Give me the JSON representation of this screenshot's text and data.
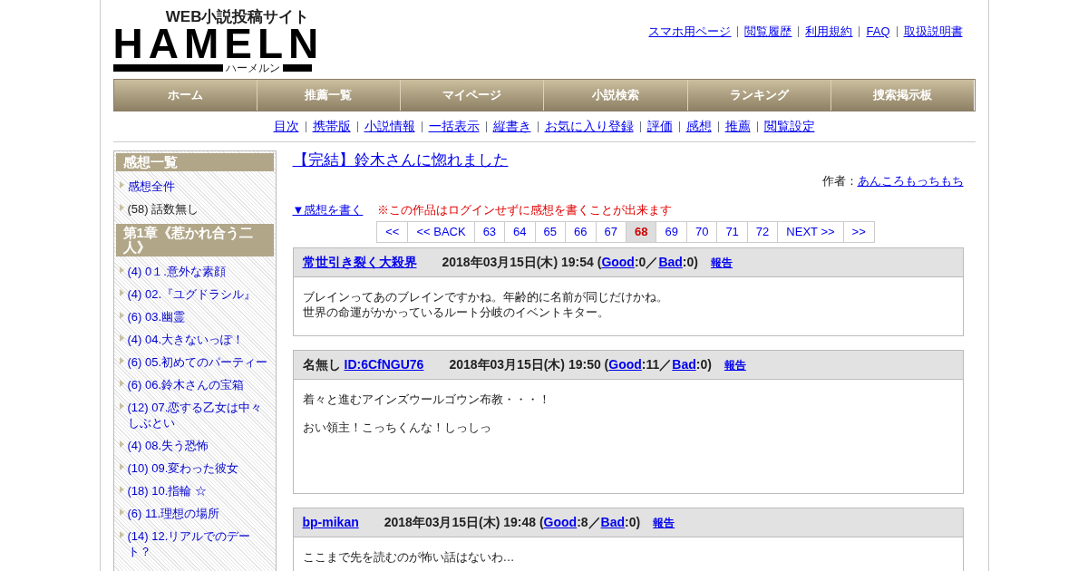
{
  "logo": {
    "tagline": "WEB小説投稿サイト",
    "wordmark": "HAMELN",
    "reading": "ハーメルン"
  },
  "top_links": [
    "スマホ用ページ",
    "閲覧履歴",
    "利用規約",
    "FAQ",
    "取扱説明書"
  ],
  "nav": [
    "ホーム",
    "推薦一覧",
    "マイページ",
    "小説検索",
    "ランキング",
    "捜索掲示板"
  ],
  "sub_nav": [
    "目次",
    "携帯版",
    "小説情報",
    "一括表示",
    "縦書き",
    "お気に入り登録",
    "評価",
    "感想",
    "推薦",
    "閲覧設定"
  ],
  "sidebar": [
    {
      "heading": "感想一覧",
      "items": [
        {
          "text": "感想全件",
          "link": true
        },
        {
          "text": "(58) 話数無し",
          "link": false
        }
      ]
    },
    {
      "heading": "第1章《惹かれ合う二人》",
      "items": [
        {
          "text": "(4) 0１.意外な素顔",
          "link": true
        },
        {
          "text": "(4) 02.『ユグドラシル』",
          "link": true
        },
        {
          "text": "(6) 03.幽霊",
          "link": true
        },
        {
          "text": "(4) 04.大きないっぽ！",
          "link": true
        },
        {
          "text": "(6) 05.初めてのパーティー",
          "link": true
        },
        {
          "text": "(6) 06.鈴木さんの宝箱",
          "link": true
        },
        {
          "text": "(12) 07.恋する乙女は中々しぶとい",
          "link": true
        },
        {
          "text": "(4) 08.失う恐怖",
          "link": true
        },
        {
          "text": "(10) 09.変わった彼女",
          "link": true
        },
        {
          "text": "(18) 10.指輪 ☆",
          "link": true
        },
        {
          "text": "(6) 11.理想の場所",
          "link": true
        },
        {
          "text": "(14) 12.リアルでのデート？",
          "link": true
        }
      ]
    }
  ],
  "work": {
    "title": "【完結】鈴木さんに惚れました",
    "author_label": "作者：",
    "author": "あんころもっちもち"
  },
  "write_link": "▼感想を書く",
  "notice": "※この作品はログインせずに感想を書くことが出来ます",
  "pagination": [
    {
      "label": "<<",
      "selected": false
    },
    {
      "label": "<< BACK",
      "selected": false
    },
    {
      "label": "63",
      "selected": false
    },
    {
      "label": "64",
      "selected": false
    },
    {
      "label": "65",
      "selected": false
    },
    {
      "label": "66",
      "selected": false
    },
    {
      "label": "67",
      "selected": false
    },
    {
      "label": "68",
      "selected": true
    },
    {
      "label": "69",
      "selected": false
    },
    {
      "label": "70",
      "selected": false
    },
    {
      "label": "71",
      "selected": false
    },
    {
      "label": "72",
      "selected": false
    },
    {
      "label": "NEXT >>",
      "selected": false
    },
    {
      "label": ">>",
      "selected": false
    }
  ],
  "comments": [
    {
      "author_link": "常世引き裂く大殺界",
      "date": "2018年03月15日(木) 19:54 (",
      "good_label": "Good",
      "good_count": ":0／",
      "bad_label": "Bad",
      "bad_count": ":0)",
      "report": "報告",
      "paragraphs": [
        [
          "ブレインってあのブレインですかね。年齢的に名前が同じだけかね。",
          "世界の命運がかかっているルート分岐のイベントキター。"
        ]
      ],
      "tall": false
    },
    {
      "author_name": "名無し",
      "author_link": "ID:6CfNGU76",
      "date": "2018年03月15日(木) 19:50 (",
      "good_label": "Good",
      "good_count": ":11／",
      "bad_label": "Bad",
      "bad_count": ":0)",
      "report": "報告",
      "paragraphs": [
        [
          "着々と進むアインズウールゴウン布教・・・！"
        ],
        [
          "おい領主！こっちくんな！しっしっ"
        ]
      ],
      "tall": true
    },
    {
      "author_link": "bp-mikan",
      "date": "2018年03月15日(木) 19:48 (",
      "good_label": "Good",
      "good_count": ":8／",
      "bad_label": "Bad",
      "bad_count": ":0)",
      "report": "報告",
      "paragraphs": [
        [
          "ここまで先を読むのが怖い話はないわ…"
        ]
      ],
      "tall": false
    }
  ]
}
